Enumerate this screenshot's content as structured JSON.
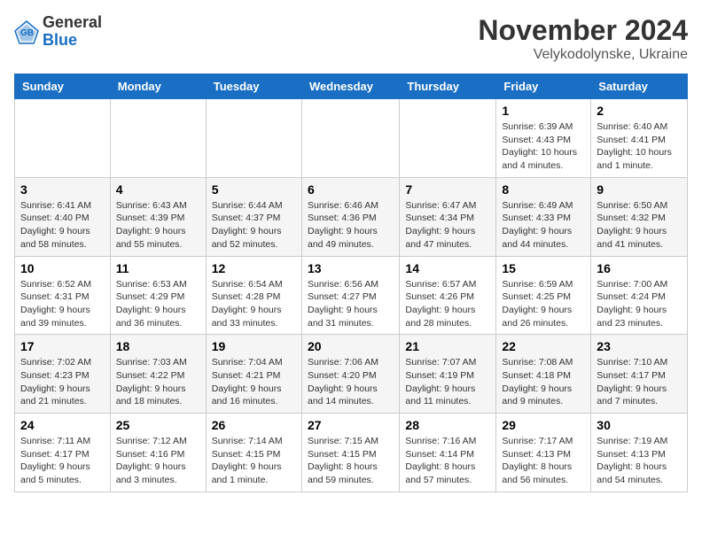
{
  "header": {
    "logo_general": "General",
    "logo_blue": "Blue",
    "month_title": "November 2024",
    "location": "Velykodolynske, Ukraine"
  },
  "days_of_week": [
    "Sunday",
    "Monday",
    "Tuesday",
    "Wednesday",
    "Thursday",
    "Friday",
    "Saturday"
  ],
  "weeks": [
    [
      {
        "day": "",
        "info": ""
      },
      {
        "day": "",
        "info": ""
      },
      {
        "day": "",
        "info": ""
      },
      {
        "day": "",
        "info": ""
      },
      {
        "day": "",
        "info": ""
      },
      {
        "day": "1",
        "info": "Sunrise: 6:39 AM\nSunset: 4:43 PM\nDaylight: 10 hours and 4 minutes."
      },
      {
        "day": "2",
        "info": "Sunrise: 6:40 AM\nSunset: 4:41 PM\nDaylight: 10 hours and 1 minute."
      }
    ],
    [
      {
        "day": "3",
        "info": "Sunrise: 6:41 AM\nSunset: 4:40 PM\nDaylight: 9 hours and 58 minutes."
      },
      {
        "day": "4",
        "info": "Sunrise: 6:43 AM\nSunset: 4:39 PM\nDaylight: 9 hours and 55 minutes."
      },
      {
        "day": "5",
        "info": "Sunrise: 6:44 AM\nSunset: 4:37 PM\nDaylight: 9 hours and 52 minutes."
      },
      {
        "day": "6",
        "info": "Sunrise: 6:46 AM\nSunset: 4:36 PM\nDaylight: 9 hours and 49 minutes."
      },
      {
        "day": "7",
        "info": "Sunrise: 6:47 AM\nSunset: 4:34 PM\nDaylight: 9 hours and 47 minutes."
      },
      {
        "day": "8",
        "info": "Sunrise: 6:49 AM\nSunset: 4:33 PM\nDaylight: 9 hours and 44 minutes."
      },
      {
        "day": "9",
        "info": "Sunrise: 6:50 AM\nSunset: 4:32 PM\nDaylight: 9 hours and 41 minutes."
      }
    ],
    [
      {
        "day": "10",
        "info": "Sunrise: 6:52 AM\nSunset: 4:31 PM\nDaylight: 9 hours and 39 minutes."
      },
      {
        "day": "11",
        "info": "Sunrise: 6:53 AM\nSunset: 4:29 PM\nDaylight: 9 hours and 36 minutes."
      },
      {
        "day": "12",
        "info": "Sunrise: 6:54 AM\nSunset: 4:28 PM\nDaylight: 9 hours and 33 minutes."
      },
      {
        "day": "13",
        "info": "Sunrise: 6:56 AM\nSunset: 4:27 PM\nDaylight: 9 hours and 31 minutes."
      },
      {
        "day": "14",
        "info": "Sunrise: 6:57 AM\nSunset: 4:26 PM\nDaylight: 9 hours and 28 minutes."
      },
      {
        "day": "15",
        "info": "Sunrise: 6:59 AM\nSunset: 4:25 PM\nDaylight: 9 hours and 26 minutes."
      },
      {
        "day": "16",
        "info": "Sunrise: 7:00 AM\nSunset: 4:24 PM\nDaylight: 9 hours and 23 minutes."
      }
    ],
    [
      {
        "day": "17",
        "info": "Sunrise: 7:02 AM\nSunset: 4:23 PM\nDaylight: 9 hours and 21 minutes."
      },
      {
        "day": "18",
        "info": "Sunrise: 7:03 AM\nSunset: 4:22 PM\nDaylight: 9 hours and 18 minutes."
      },
      {
        "day": "19",
        "info": "Sunrise: 7:04 AM\nSunset: 4:21 PM\nDaylight: 9 hours and 16 minutes."
      },
      {
        "day": "20",
        "info": "Sunrise: 7:06 AM\nSunset: 4:20 PM\nDaylight: 9 hours and 14 minutes."
      },
      {
        "day": "21",
        "info": "Sunrise: 7:07 AM\nSunset: 4:19 PM\nDaylight: 9 hours and 11 minutes."
      },
      {
        "day": "22",
        "info": "Sunrise: 7:08 AM\nSunset: 4:18 PM\nDaylight: 9 hours and 9 minutes."
      },
      {
        "day": "23",
        "info": "Sunrise: 7:10 AM\nSunset: 4:17 PM\nDaylight: 9 hours and 7 minutes."
      }
    ],
    [
      {
        "day": "24",
        "info": "Sunrise: 7:11 AM\nSunset: 4:17 PM\nDaylight: 9 hours and 5 minutes."
      },
      {
        "day": "25",
        "info": "Sunrise: 7:12 AM\nSunset: 4:16 PM\nDaylight: 9 hours and 3 minutes."
      },
      {
        "day": "26",
        "info": "Sunrise: 7:14 AM\nSunset: 4:15 PM\nDaylight: 9 hours and 1 minute."
      },
      {
        "day": "27",
        "info": "Sunrise: 7:15 AM\nSunset: 4:15 PM\nDaylight: 8 hours and 59 minutes."
      },
      {
        "day": "28",
        "info": "Sunrise: 7:16 AM\nSunset: 4:14 PM\nDaylight: 8 hours and 57 minutes."
      },
      {
        "day": "29",
        "info": "Sunrise: 7:17 AM\nSunset: 4:13 PM\nDaylight: 8 hours and 56 minutes."
      },
      {
        "day": "30",
        "info": "Sunrise: 7:19 AM\nSunset: 4:13 PM\nDaylight: 8 hours and 54 minutes."
      }
    ]
  ]
}
